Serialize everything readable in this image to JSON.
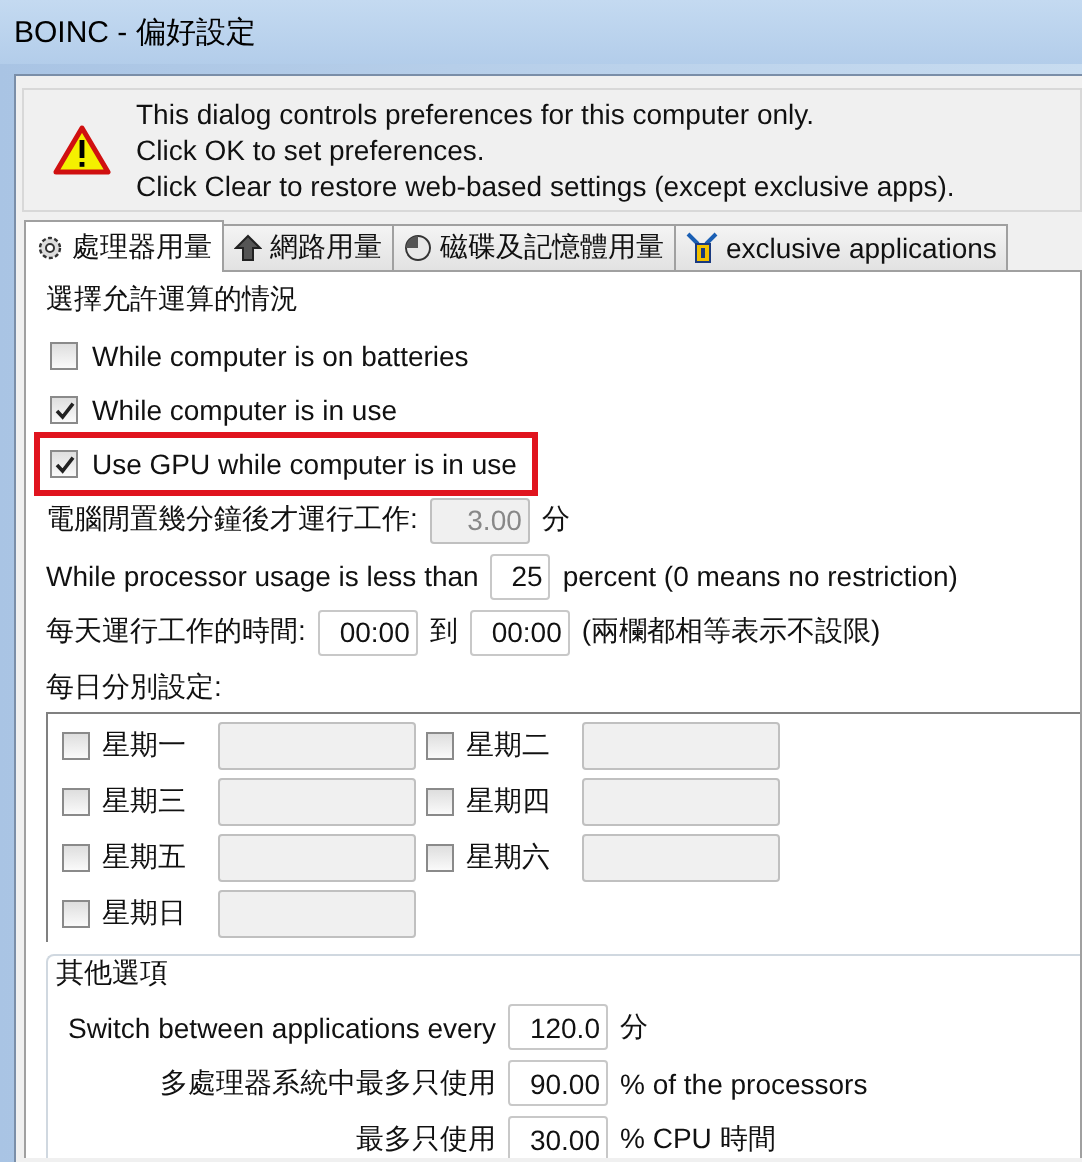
{
  "window": {
    "title": "BOINC - 偏好設定"
  },
  "notice": {
    "lines": [
      "This dialog controls preferences for this computer only.",
      "Click OK to set preferences.",
      "Click Clear to restore web-based settings (except exclusive apps)."
    ]
  },
  "tabs": [
    {
      "label": "處理器用量",
      "selected": true
    },
    {
      "label": "網路用量",
      "selected": false
    },
    {
      "label": "磁碟及記憶體用量",
      "selected": false
    },
    {
      "label": "exclusive applications",
      "selected": false
    }
  ],
  "compute": {
    "title": "選擇允許運算的情況",
    "checkboxes": [
      {
        "label": "While computer is on batteries",
        "checked": false,
        "highlighted": false
      },
      {
        "label": "While computer is in use",
        "checked": true,
        "highlighted": false
      },
      {
        "label": "Use GPU while computer is in use",
        "checked": true,
        "highlighted": true
      }
    ],
    "rows": [
      {
        "kind": "single",
        "label": "電腦閒置幾分鐘後才運行工作:",
        "value": "3.00",
        "unit": "分",
        "disabled": true
      },
      {
        "kind": "single",
        "label": "While processor usage is less than",
        "value": "25",
        "unit": "percent (0 means no restriction)",
        "disabled": false
      },
      {
        "kind": "range",
        "label": "每天運行工作的時間:",
        "from": "00:00",
        "to_label": "到",
        "to": "00:00",
        "note": "(兩欄都相等表示不設限)"
      }
    ]
  },
  "daily": {
    "title": "每日分別設定:",
    "days": [
      {
        "label": "星期一",
        "checked": false
      },
      {
        "label": "星期二",
        "checked": false
      },
      {
        "label": "星期三",
        "checked": false
      },
      {
        "label": "星期四",
        "checked": false
      },
      {
        "label": "星期五",
        "checked": false
      },
      {
        "label": "星期六",
        "checked": false
      },
      {
        "label": "星期日",
        "checked": false
      }
    ]
  },
  "other": {
    "title": "其他選項",
    "rows": [
      {
        "label": "Switch between applications every",
        "value": "120.0",
        "unit": "分"
      },
      {
        "label": "多處理器系統中最多只使用",
        "value": "90.00",
        "unit": "% of the processors"
      },
      {
        "label": "最多只使用",
        "value": "30.00",
        "unit": "% CPU 時間"
      }
    ]
  }
}
